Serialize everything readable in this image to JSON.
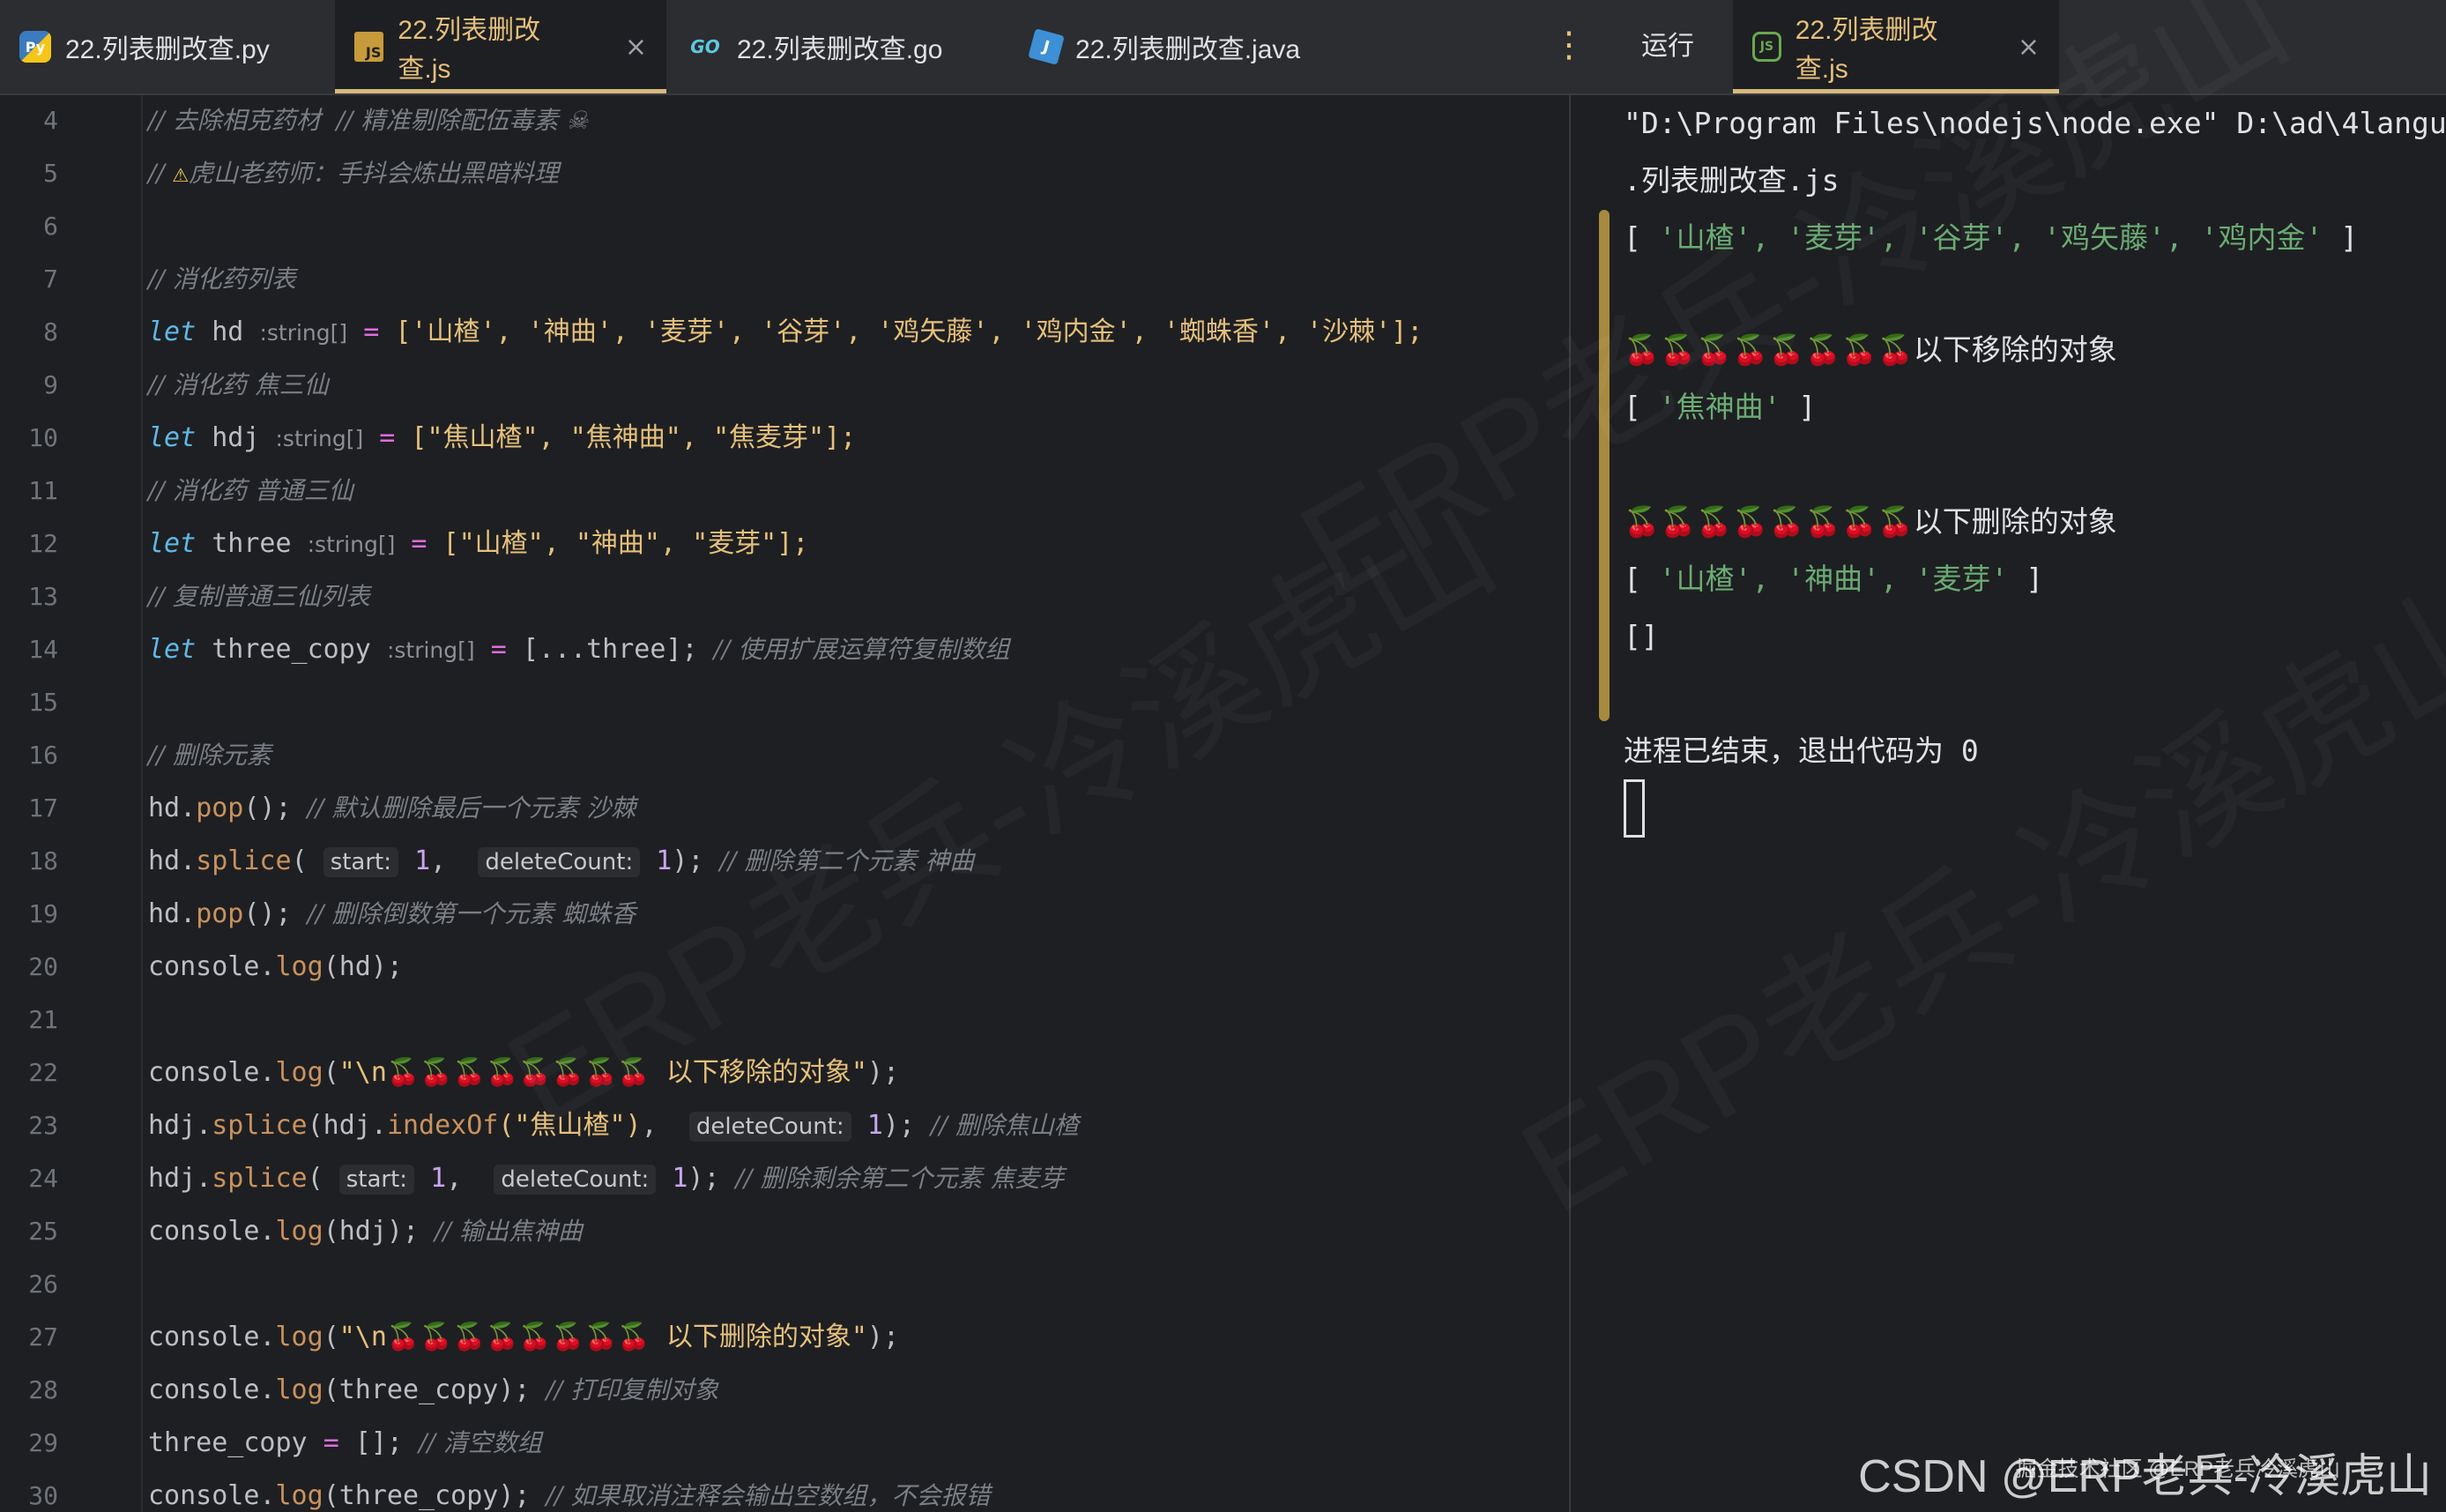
{
  "tabs": [
    {
      "label": "22.列表删改查.py",
      "icon": "python-icon"
    },
    {
      "label": "22.列表删改查.js",
      "icon": "javascript-icon",
      "active": true
    },
    {
      "label": "22.列表删改查.go",
      "icon": "go-icon"
    },
    {
      "label": "22.列表删改查.java",
      "icon": "java-icon"
    }
  ],
  "run_tab": {
    "title": "运行",
    "file_label": "22.列表删改查.js"
  },
  "editor": {
    "line_numbers": [
      "4",
      "5",
      "6",
      "7",
      "8",
      "9",
      "10",
      "11",
      "12",
      "13",
      "14",
      "15",
      "16",
      "17",
      "18",
      "19",
      "20",
      "21",
      "22",
      "23",
      "24",
      "25",
      "26",
      "27",
      "28",
      "29",
      "30"
    ],
    "code": {
      "l4_comment": "// 去除相克药材  // 精准剔除配伍毒素 ☠",
      "l5_comment_a": "// ",
      "l5_warn": "⚠",
      "l5_comment_b": "虎山老药师：手抖会炼出黑暗料理",
      "l7_comment": "// 消化药列表",
      "l8_kw": "let",
      "l8_name": " hd ",
      "l8_type": ":string[]",
      "l8_eq": " = ",
      "l8_val": "['山楂', '神曲', '麦芽', '谷芽', '鸡矢藤', '鸡内金', '蜘蛛香', '沙棘'];",
      "l9_comment": "// 消化药 焦三仙",
      "l10_kw": "let",
      "l10_name": " hdj ",
      "l10_type": ":string[]",
      "l10_eq": " = ",
      "l10_val": "[\"焦山楂\", \"焦神曲\", \"焦麦芽\"];",
      "l11_comment": "// 消化药 普通三仙",
      "l12_kw": "let",
      "l12_name": " three ",
      "l12_type": ":string[]",
      "l12_eq": " = ",
      "l12_val": "[\"山楂\", \"神曲\", \"麦芽\"];",
      "l13_comment": "// 复制普通三仙列表",
      "l14_kw": "let",
      "l14_name": " three_copy ",
      "l14_type": ":string[]",
      "l14_eq": " = ",
      "l14_val": "[...three]; ",
      "l14_comment": "// 使用扩展运算符复制数组",
      "l16_comment": "// 删除元素",
      "l17_obj": "hd.",
      "l17_m": "pop",
      "l17_rest": "(); ",
      "l17_comment": "// 默认删除最后一个元素 沙棘",
      "l18_obj": "hd.",
      "l18_m": "splice",
      "l18_p1": "( ",
      "l18_h1": "start:",
      "l18_n1": " 1",
      "l18_c": ",  ",
      "l18_h2": "deleteCount:",
      "l18_n2": " 1",
      "l18_end": "); ",
      "l18_comment": "// 删除第二个元素 神曲",
      "l19_obj": "hd.",
      "l19_m": "pop",
      "l19_rest": "(); ",
      "l19_comment": "// 删除倒数第一个元素 蜘蛛香",
      "l20_obj": "console.",
      "l20_m": "log",
      "l20_rest": "(hd);",
      "l22_obj": "console.",
      "l22_m": "log",
      "l22_p": "(",
      "l22_str": "\"\\n🍒🍒🍒🍒🍒🍒🍒🍒 以下移除的对象\"",
      "l22_end": ");",
      "l23_obj": "hdj.",
      "l23_m": "splice",
      "l23_p": "(hdj.",
      "l23_m2": "indexOf",
      "l23_s": "(\"焦山楂\")",
      "l23_c": ",  ",
      "l23_h": "deleteCount:",
      "l23_n": " 1",
      "l23_end": "); ",
      "l23_comment": "// 删除焦山楂",
      "l24_obj": "hdj.",
      "l24_m": "splice",
      "l24_p1": "( ",
      "l24_h1": "start:",
      "l24_n1": " 1",
      "l24_c": ",  ",
      "l24_h2": "deleteCount:",
      "l24_n2": " 1",
      "l24_end": "); ",
      "l24_comment": "// 删除剩余第二个元素 焦麦芽",
      "l25_obj": "console.",
      "l25_m": "log",
      "l25_rest": "(hdj); ",
      "l25_comment": "// 输出焦神曲",
      "l27_obj": "console.",
      "l27_m": "log",
      "l27_p": "(",
      "l27_str": "\"\\n🍒🍒🍒🍒🍒🍒🍒🍒 以下删除的对象\"",
      "l27_end": ");",
      "l28_obj": "console.",
      "l28_m": "log",
      "l28_rest": "(three_copy); ",
      "l28_comment": "// 打印复制对象",
      "l29_a": "three_copy ",
      "l29_eq": "=",
      "l29_b": " []; ",
      "l29_comment": "// 清空数组",
      "l30_obj": "console.",
      "l30_m": "log",
      "l30_rest": "(three_copy); ",
      "l30_comment": "// 如果取消注释会输出空数组，不会报错"
    }
  },
  "output": {
    "cmd_line1": "\"D:\\Program Files\\nodejs\\node.exe\" D:\\ad\\4langu",
    "cmd_line2": ".列表删改查.js",
    "arr1_open": "[ ",
    "arr1_items": "'山楂', '麦芽', '谷芽', '鸡矢藤', '鸡内金'",
    "arr1_close": " ]",
    "sep1": "🍒🍒🍒🍒🍒🍒🍒🍒以下移除的对象",
    "arr2_open": "[ ",
    "arr2_items": "'焦神曲'",
    "arr2_close": " ]",
    "sep2": "🍒🍒🍒🍒🍒🍒🍒🍒以下删除的对象",
    "arr3_open": "[ ",
    "arr3_items": "'山楂', '神曲', '麦芽'",
    "arr3_close": " ]",
    "empty_arr": "[]",
    "exit_msg": "进程已结束，退出代码为 0"
  },
  "watermark": {
    "text": "ERP老兵-冷溪虎山",
    "csdn": "CSDN @ERP老兵-冷溪虎山",
    "csdn_small": "掘金技术社区 @ERP老兵冷溪虎山"
  },
  "colors": {
    "background": "#1e1f22",
    "keyword": "#5fb7e6",
    "string": "#e5c07b",
    "comment": "#7a7e85",
    "output_string": "#6aab73"
  }
}
